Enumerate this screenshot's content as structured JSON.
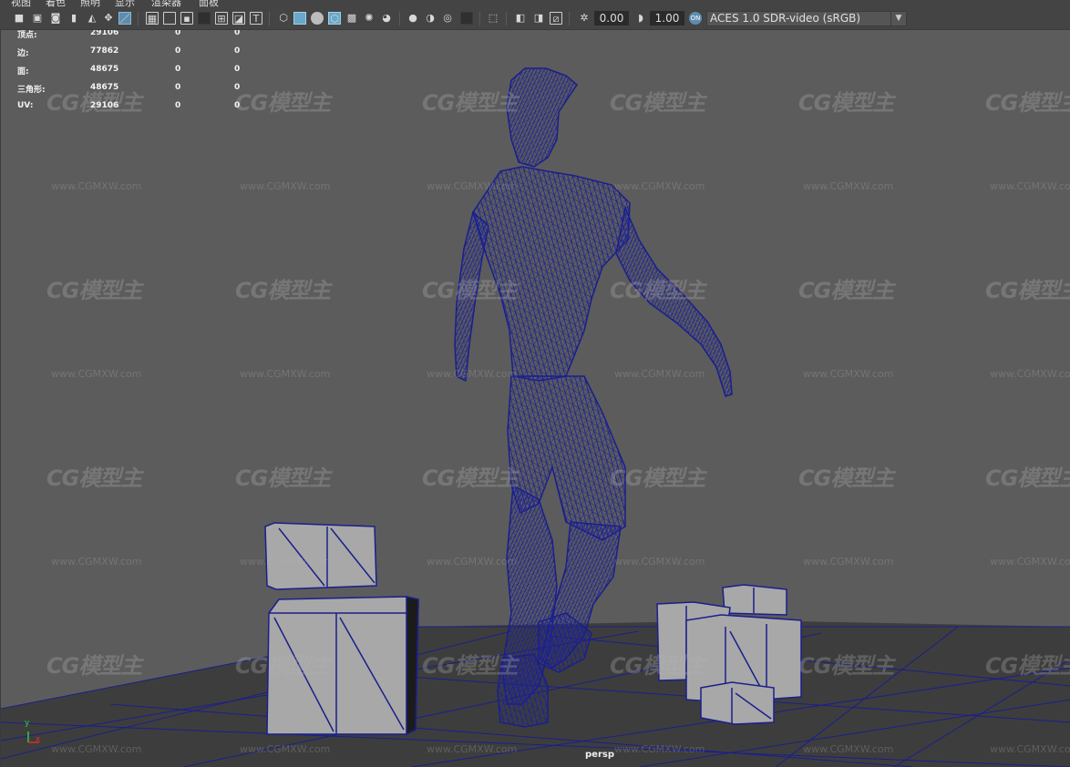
{
  "menu": {
    "items": [
      "视图",
      "着色",
      "照明",
      "显示",
      "渲染器",
      "面板"
    ]
  },
  "toolbar": {
    "exposure_value": "0.00",
    "gamma_value": "1.00",
    "color_space": "ACES 1.0 SDR-video (sRGB)",
    "icons": [
      "camera-icon",
      "camera-attributes-icon",
      "bookmark-icon",
      "image-plane-icon",
      "grid-toggle-icon",
      "film-gate-icon",
      "resolution-gate-icon",
      "gate-mask-icon",
      "field-chart-icon",
      "safe-action-icon",
      "safe-title-icon",
      "wireframe-icon",
      "smooth-shade-icon",
      "wireframe-on-shaded-icon",
      "xray-icon",
      "use-default-material-icon",
      "textured-icon",
      "lights-icon",
      "shadows-icon",
      "screen-space-ao-icon",
      "motion-blur-icon",
      "anti-aliasing-icon",
      "depth-of-field-icon",
      "isolate-select-icon",
      "xray-joints-icon",
      "xray-active-icon",
      "backface-culling-icon",
      "exposure-icon",
      "gamma-icon",
      "color-management-icon"
    ]
  },
  "hud": {
    "rows": [
      {
        "label": "顶点:",
        "v1": "29106",
        "v2": "0",
        "v3": "0"
      },
      {
        "label": "边:",
        "v1": "77862",
        "v2": "0",
        "v3": "0"
      },
      {
        "label": "面:",
        "v1": "48675",
        "v2": "0",
        "v3": "0"
      },
      {
        "label": "三角形:",
        "v1": "48675",
        "v2": "0",
        "v3": "0"
      },
      {
        "label": "UV:",
        "v1": "29106",
        "v2": "0",
        "v3": "0"
      }
    ]
  },
  "viewport": {
    "camera_name": "persp",
    "axis_labels": {
      "x": "x",
      "y": "y"
    }
  },
  "watermark": {
    "logo_text": "CG模型主",
    "url_text": "www.CGMXW.com"
  },
  "colors": {
    "wireframe": "#1a1f8c",
    "viewport_bg": "#5c5c5c",
    "ground": "#3f3f3f",
    "box_fill": "#a9a9a9",
    "toolbar_bg": "#444444",
    "accent": "#5d8cae"
  }
}
